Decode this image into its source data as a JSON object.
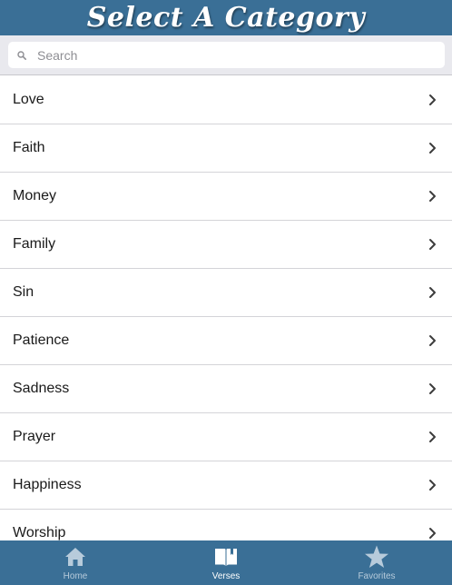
{
  "header": {
    "title": "Select A Category"
  },
  "search": {
    "placeholder": "Search",
    "value": ""
  },
  "categories": [
    {
      "label": "Love"
    },
    {
      "label": "Faith"
    },
    {
      "label": "Money"
    },
    {
      "label": "Family"
    },
    {
      "label": "Sin"
    },
    {
      "label": "Patience"
    },
    {
      "label": "Sadness"
    },
    {
      "label": "Prayer"
    },
    {
      "label": "Happiness"
    },
    {
      "label": "Worship"
    }
  ],
  "tabbar": {
    "active_tab": "Verses",
    "tabs": [
      {
        "label": "Home",
        "icon": "home-icon"
      },
      {
        "label": "Verses",
        "icon": "book-icon"
      },
      {
        "label": "Favorites",
        "icon": "star-icon"
      }
    ]
  },
  "colors": {
    "accent": "#3a6f96",
    "search_bg": "#e9e9ee",
    "divider": "#d4d4d8",
    "inactive_tab_text": "#b7cbdb"
  }
}
